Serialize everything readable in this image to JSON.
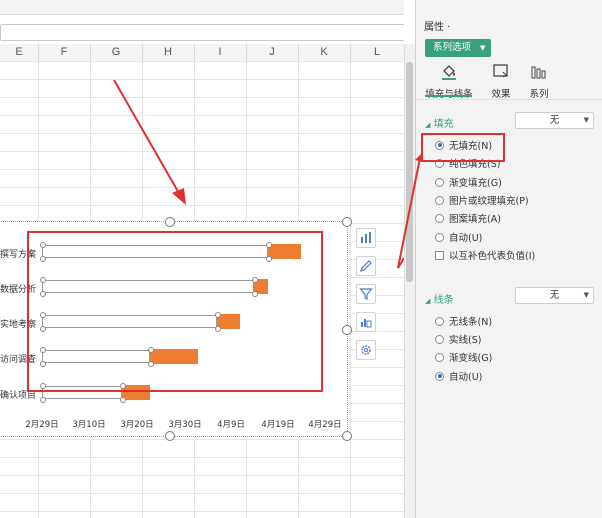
{
  "sheet": {
    "columns": [
      "E",
      "F",
      "G",
      "H",
      "I",
      "J",
      "K",
      "L"
    ],
    "chart": {
      "tasks": [
        {
          "label": "撰写方案",
          "start": 0,
          "duration": 7
        },
        {
          "label": "数据分析",
          "start": 0,
          "duration": 3
        },
        {
          "label": "实地考察",
          "start": 0,
          "duration": 5
        },
        {
          "label": "访问调查",
          "start": 0,
          "duration": 10
        },
        {
          "label": "确认项目",
          "start": 0,
          "duration": 6
        }
      ],
      "x_ticks": [
        "2月29日",
        "3月10日",
        "3月20日",
        "3月30日",
        "4月9日",
        "4月19日",
        "4月29日"
      ]
    }
  },
  "chart_data": {
    "type": "bar",
    "orientation": "horizontal",
    "stacked": true,
    "categories": [
      "撰写方案",
      "数据分析",
      "实地考察",
      "访问调查",
      "确认项目"
    ],
    "series": [
      {
        "values": [
          "2020-04-17",
          "2020-04-14",
          "2020-04-06",
          "2020-03-23",
          "2020-03-17"
        ],
        "fill": "none"
      },
      {
        "values": [
          7,
          3,
          5,
          10,
          6
        ],
        "color": "#ED7D31"
      }
    ],
    "xlim": [
      "2020-02-29",
      "2020-04-29"
    ],
    "x_ticks": [
      "2月29日",
      "3月10日",
      "3月20日",
      "3月30日",
      "4月9日",
      "4月19日",
      "4月29日"
    ]
  },
  "pane": {
    "title": "属性 ·",
    "series_tab": "系列选项",
    "subtabs": [
      {
        "label": "填充与线条",
        "icon": "paint-bucket-icon"
      },
      {
        "label": "效果",
        "icon": "effects-icon"
      },
      {
        "label": "系列",
        "icon": "bar-chart-icon"
      }
    ],
    "fill": {
      "section": "填充",
      "dropdown": "无",
      "options": [
        {
          "label": "无填充(N)",
          "selected": true
        },
        {
          "label": "纯色填充(S)",
          "selected": false
        },
        {
          "label": "渐变填充(G)",
          "selected": false
        },
        {
          "label": "图片或纹理填充(P)",
          "selected": false
        },
        {
          "label": "图案填充(A)",
          "selected": false
        },
        {
          "label": "自动(U)",
          "selected": false
        }
      ],
      "checkbox": "以互补色代表负值(I)"
    },
    "line": {
      "section": "线条",
      "dropdown": "无",
      "options": [
        {
          "label": "无线条(N)",
          "selected": false
        },
        {
          "label": "实线(S)",
          "selected": false
        },
        {
          "label": "渐变线(G)",
          "selected": false
        },
        {
          "label": "自动(U)",
          "selected": true
        }
      ]
    },
    "accent_color": "#3AA17E",
    "highlight_color": "#E03030",
    "bar_color": "#ED7D31"
  }
}
